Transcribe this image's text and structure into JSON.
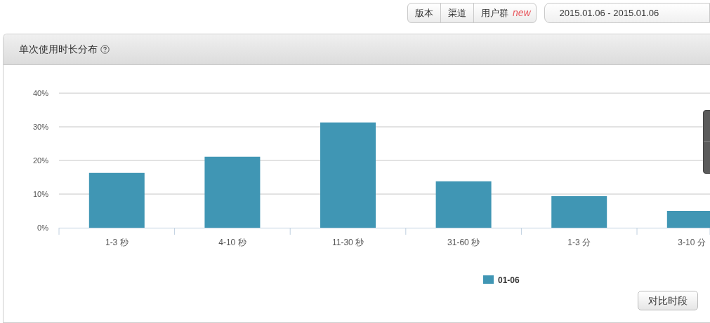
{
  "filters": [
    {
      "label": "版本"
    },
    {
      "label": "渠道"
    },
    {
      "label": "用户群",
      "badge": "new"
    }
  ],
  "date_range": "2015.01.06 - 2015.01.06",
  "panel": {
    "title": "单次使用时长分布",
    "chart_data": {
      "type": "bar",
      "categories": [
        "1-3 秒",
        "4-10 秒",
        "11-30 秒",
        "31-60 秒",
        "1-3 分",
        "3-10 分"
      ],
      "ylim": [
        0,
        40
      ],
      "grid": true,
      "yticks": [
        {
          "value": 0,
          "label": "0%"
        },
        {
          "value": 10,
          "label": "10%"
        },
        {
          "value": 20,
          "label": "20%"
        },
        {
          "value": 30,
          "label": "30%"
        },
        {
          "value": 40,
          "label": "40%"
        }
      ],
      "series": [
        {
          "name": "01-06",
          "color": "#4096b4",
          "values": [
            16.3,
            21.1,
            31.3,
            13.8,
            9.4,
            5.0
          ]
        }
      ]
    },
    "compare_button": "对比时段"
  }
}
